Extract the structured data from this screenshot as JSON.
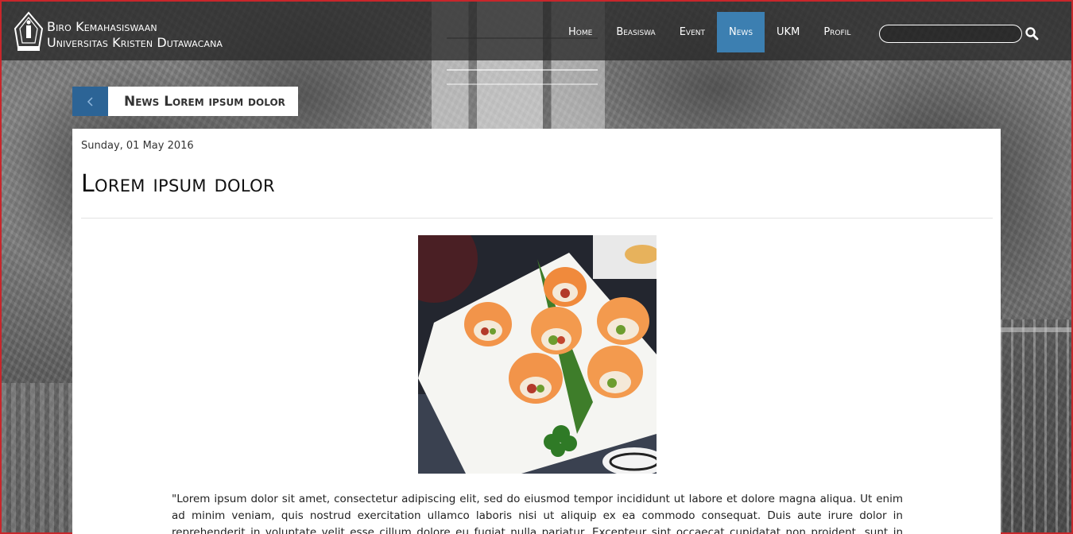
{
  "header": {
    "brand_line1": "Biro Kemahasiswaan",
    "brand_line2": "Universitas Kristen Dutawacana",
    "nav": [
      {
        "label": "Home",
        "active": false
      },
      {
        "label": "Beasiswa",
        "active": false
      },
      {
        "label": "Event",
        "active": false
      },
      {
        "label": "News",
        "active": true
      },
      {
        "label": "UKM",
        "active": false
      },
      {
        "label": "Profil",
        "active": false
      }
    ],
    "search": {
      "value": "",
      "placeholder": "",
      "icon": "search-icon"
    }
  },
  "breadcrumb": {
    "back_icon": "chevron-left-icon",
    "title": "News Lorem ipsum dolor"
  },
  "article": {
    "date": "Sunday, 01 May 2016",
    "title": "Lorem ipsum dolor",
    "image": "sushi-plate-photo",
    "body": "\"Lorem ipsum dolor sit amet, consectetur adipiscing elit, sed do eiusmod tempor incididunt ut labore et dolore magna aliqua. Ut enim ad minim veniam, quis nostrud exercitation ullamco laboris nisi ut aliquip ex ea commodo consequat. Duis aute irure dolor in reprehenderit in voluptate velit esse cillum dolore eu fugiat nulla pariatur. Excepteur sint occaecat cupidatat non proident, sunt in culpa qui officia deserunt"
  },
  "colors": {
    "accent": "#3c7fb1",
    "back_button": "#2c6496",
    "header_bg": "#282828",
    "frame_border": "#c8262b"
  }
}
